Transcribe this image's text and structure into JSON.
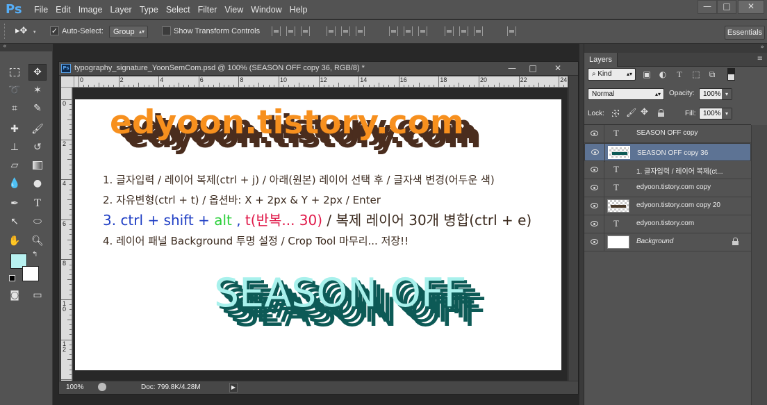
{
  "app": {
    "logo": "Ps"
  },
  "menu": [
    "File",
    "Edit",
    "Image",
    "Layer",
    "Type",
    "Select",
    "Filter",
    "View",
    "Window",
    "Help"
  ],
  "window_controls": {
    "minimize": "—",
    "restore": "□",
    "close": "✕"
  },
  "options_bar": {
    "auto_select_label": "Auto-Select:",
    "auto_select_checked": true,
    "auto_select_value": "Group",
    "transform_label": "Show Transform Controls",
    "transform_checked": false,
    "workspace": "Essentials"
  },
  "tools": [
    "marquee-icon",
    "move-icon",
    "lasso-icon",
    "magic-wand-icon",
    "crop-icon",
    "eyedropper-icon",
    "healing-icon",
    "brush-icon",
    "stamp-icon",
    "history-brush-icon",
    "eraser-icon",
    "gradient-icon",
    "blur-icon",
    "dodge-icon",
    "pen-icon",
    "type-icon",
    "path-select-icon",
    "ellipse-icon",
    "hand-icon",
    "zoom-icon"
  ],
  "colors": {
    "foreground": "#b8f1f0",
    "background": "#ffffff",
    "selected_layer": "#5d7394"
  },
  "document": {
    "title": "typography_signature_YoonSemCom.psd @ 100% (SEASON OFF copy 36, RGB/8) *",
    "zoom": "100%",
    "doc_size": "Doc: 799.8K/4.28M",
    "ruler_h": [
      "0",
      "2",
      "4",
      "6",
      "8",
      "10",
      "12",
      "14",
      "16",
      "18",
      "20",
      "22",
      "24"
    ],
    "ruler_v": [
      "0",
      "2",
      "4",
      "6",
      "8",
      "1 0",
      "1 2"
    ]
  },
  "canvas": {
    "headline": "edyoon.tistory.com",
    "steps": [
      "1. 글자입력 / 레이어 복제(ctrl + j) / 아래(원본) 레이어 선택 후 / 글자색 변경(어두운 색)",
      "2. 자유변형(ctrl + t)  /  옵션바: X + 2px & Y + 2px  /  Enter",
      "4. 레이어 패널 Background 투명 설정  /  Crop Tool 마무리... 저장!!"
    ],
    "step3": {
      "a": "3. ctrl + shift + ",
      "b": "alt",
      "c": " ,  ",
      "d": "t(반복... 30)",
      "e": "  /  복제 레이어 30개 병합(ctrl + e)"
    },
    "step_colors": {
      "blue": "#1f3ec4",
      "green": "#2bd03a",
      "red": "#e01a4a"
    },
    "season": "SEASON OFF",
    "headline_color": "#f7901e",
    "headline_shadow": "#4a2d1e",
    "season_color": "#a8f1ec",
    "season_shadow": "#0d5a56"
  },
  "layers_panel": {
    "tab": "Layers",
    "menu_icon": "≡",
    "kind_label": "Kind",
    "blend_mode": "Normal",
    "opacity_label": "Opacity:",
    "opacity": "100%",
    "lock_label": "Lock:",
    "fill_label": "Fill:",
    "fill": "100%",
    "layers": [
      {
        "name": "SEASON OFF copy",
        "kind": "text",
        "selected": false
      },
      {
        "name": "SEASON OFF copy 36",
        "kind": "raster",
        "selected": true
      },
      {
        "name": "1. 글자입력 / 레이어 복제(ct...",
        "kind": "text",
        "selected": false
      },
      {
        "name": "edyoon.tistory.com copy",
        "kind": "text",
        "selected": false
      },
      {
        "name": "edyoon.tistory.com copy 20",
        "kind": "raster",
        "selected": false
      },
      {
        "name": "edyoon.tistory.com",
        "kind": "text",
        "selected": false
      },
      {
        "name": "Background",
        "kind": "background",
        "selected": false
      }
    ]
  }
}
